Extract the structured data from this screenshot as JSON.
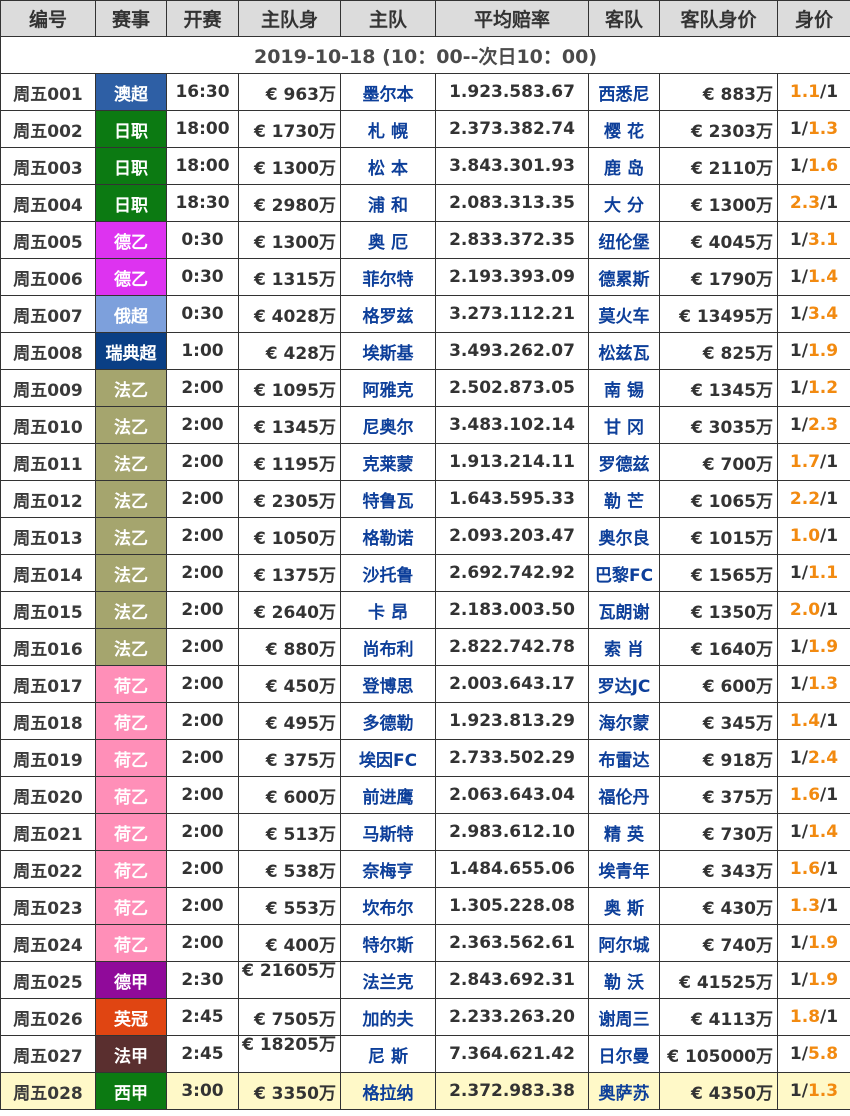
{
  "headers": [
    "编号",
    "赛事",
    "开赛",
    "主队身",
    "主队",
    "平均赔率",
    "客队",
    "客队身价",
    "身价"
  ],
  "date_banner": "2019-10-18 (10：00--次日10：00)",
  "league_colors": {
    "澳超": "#2e5fa5",
    "日职": "#0c7a12",
    "德乙": "#dd33f0",
    "俄超": "#7da0dc",
    "瑞典超": "#0a3f85",
    "法乙": "#a5a56e",
    "荷乙": "#ff8fb8",
    "德甲": "#900a9a",
    "英冠": "#e04512",
    "法甲": "#5a2f2f",
    "西甲": "#0c7a12"
  },
  "rows": [
    {
      "id": "周五001",
      "league": "澳超",
      "time": "16:30",
      "home_val": "€ 963万",
      "home": "墨尔本",
      "odds": "1.923.583.67",
      "away": "西悉尼",
      "away_val": "€ 883万",
      "ratio_a": "1.1",
      "ratio_b": "1",
      "hl": "a"
    },
    {
      "id": "周五002",
      "league": "日职",
      "time": "18:00",
      "home_val": "€ 1730万",
      "home": "札 幌",
      "odds": "2.373.382.74",
      "away": "樱 花",
      "away_val": "€ 2303万",
      "ratio_a": "1",
      "ratio_b": "1.3",
      "hl": "b"
    },
    {
      "id": "周五003",
      "league": "日职",
      "time": "18:00",
      "home_val": "€ 1300万",
      "home": "松 本",
      "odds": "3.843.301.93",
      "away": "鹿 岛",
      "away_val": "€ 2110万",
      "ratio_a": "1",
      "ratio_b": "1.6",
      "hl": "b"
    },
    {
      "id": "周五004",
      "league": "日职",
      "time": "18:30",
      "home_val": "€ 2980万",
      "home": "浦 和",
      "odds": "2.083.313.35",
      "away": "大 分",
      "away_val": "€ 1300万",
      "ratio_a": "2.3",
      "ratio_b": "1",
      "hl": "a"
    },
    {
      "id": "周五005",
      "league": "德乙",
      "time": "0:30",
      "home_val": "€ 1300万",
      "home": "奥 厄",
      "odds": "2.833.372.35",
      "away": "纽伦堡",
      "away_val": "€ 4045万",
      "ratio_a": "1",
      "ratio_b": "3.1",
      "hl": "b"
    },
    {
      "id": "周五006",
      "league": "德乙",
      "time": "0:30",
      "home_val": "€ 1315万",
      "home": "菲尔特",
      "odds": "2.193.393.09",
      "away": "德累斯",
      "away_val": "€ 1790万",
      "ratio_a": "1",
      "ratio_b": "1.4",
      "hl": "b"
    },
    {
      "id": "周五007",
      "league": "俄超",
      "time": "0:30",
      "home_val": "€ 4028万",
      "home": "格罗兹",
      "odds": "3.273.112.21",
      "away": "莫火车",
      "away_val": "€ 13495万",
      "ratio_a": "1",
      "ratio_b": "3.4",
      "hl": "b"
    },
    {
      "id": "周五008",
      "league": "瑞典超",
      "time": "1:00",
      "home_val": "€ 428万",
      "home": "埃斯基",
      "odds": "3.493.262.07",
      "away": "松兹瓦",
      "away_val": "€ 825万",
      "ratio_a": "1",
      "ratio_b": "1.9",
      "hl": "b"
    },
    {
      "id": "周五009",
      "league": "法乙",
      "time": "2:00",
      "home_val": "€ 1095万",
      "home": "阿雅克",
      "odds": "2.502.873.05",
      "away": "南 锡",
      "away_val": "€ 1345万",
      "ratio_a": "1",
      "ratio_b": "1.2",
      "hl": "b"
    },
    {
      "id": "周五010",
      "league": "法乙",
      "time": "2:00",
      "home_val": "€ 1345万",
      "home": "尼奥尔",
      "odds": "3.483.102.14",
      "away": "甘 冈",
      "away_val": "€ 3035万",
      "ratio_a": "1",
      "ratio_b": "2.3",
      "hl": "b"
    },
    {
      "id": "周五011",
      "league": "法乙",
      "time": "2:00",
      "home_val": "€ 1195万",
      "home": "克莱蒙",
      "odds": "1.913.214.11",
      "away": "罗德兹",
      "away_val": "€ 700万",
      "ratio_a": "1.7",
      "ratio_b": "1",
      "hl": "a"
    },
    {
      "id": "周五012",
      "league": "法乙",
      "time": "2:00",
      "home_val": "€ 2305万",
      "home": "特鲁瓦",
      "odds": "1.643.595.33",
      "away": "勒 芒",
      "away_val": "€ 1065万",
      "ratio_a": "2.2",
      "ratio_b": "1",
      "hl": "a"
    },
    {
      "id": "周五013",
      "league": "法乙",
      "time": "2:00",
      "home_val": "€ 1050万",
      "home": "格勒诺",
      "odds": "2.093.203.47",
      "away": "奥尔良",
      "away_val": "€ 1015万",
      "ratio_a": "1.0",
      "ratio_b": "1",
      "hl": "a"
    },
    {
      "id": "周五014",
      "league": "法乙",
      "time": "2:00",
      "home_val": "€ 1375万",
      "home": "沙托鲁",
      "odds": "2.692.742.92",
      "away": "巴黎FC",
      "away_val": "€ 1565万",
      "ratio_a": "1",
      "ratio_b": "1.1",
      "hl": "b"
    },
    {
      "id": "周五015",
      "league": "法乙",
      "time": "2:00",
      "home_val": "€ 2640万",
      "home": "卡 昂",
      "odds": "2.183.003.50",
      "away": "瓦朗谢",
      "away_val": "€ 1350万",
      "ratio_a": "2.0",
      "ratio_b": "1",
      "hl": "a"
    },
    {
      "id": "周五016",
      "league": "法乙",
      "time": "2:00",
      "home_val": "€ 880万",
      "home": "尚布利",
      "odds": "2.822.742.78",
      "away": "索 肖",
      "away_val": "€ 1640万",
      "ratio_a": "1",
      "ratio_b": "1.9",
      "hl": "b"
    },
    {
      "id": "周五017",
      "league": "荷乙",
      "time": "2:00",
      "home_val": "€ 450万",
      "home": "登博思",
      "odds": "2.003.643.17",
      "away": "罗达JC",
      "away_val": "€ 600万",
      "ratio_a": "1",
      "ratio_b": "1.3",
      "hl": "b"
    },
    {
      "id": "周五018",
      "league": "荷乙",
      "time": "2:00",
      "home_val": "€ 495万",
      "home": "多德勒",
      "odds": "1.923.813.29",
      "away": "海尔蒙",
      "away_val": "€ 345万",
      "ratio_a": "1.4",
      "ratio_b": "1",
      "hl": "a"
    },
    {
      "id": "周五019",
      "league": "荷乙",
      "time": "2:00",
      "home_val": "€ 375万",
      "home": "埃因FC",
      "odds": "2.733.502.29",
      "away": "布雷达",
      "away_val": "€ 918万",
      "ratio_a": "1",
      "ratio_b": "2.4",
      "hl": "b"
    },
    {
      "id": "周五020",
      "league": "荷乙",
      "time": "2:00",
      "home_val": "€ 600万",
      "home": "前进鹰",
      "odds": "2.063.643.04",
      "away": "福伦丹",
      "away_val": "€ 375万",
      "ratio_a": "1.6",
      "ratio_b": "1",
      "hl": "a"
    },
    {
      "id": "周五021",
      "league": "荷乙",
      "time": "2:00",
      "home_val": "€ 513万",
      "home": "马斯特",
      "odds": "2.983.612.10",
      "away": "精 英",
      "away_val": "€ 730万",
      "ratio_a": "1",
      "ratio_b": "1.4",
      "hl": "b"
    },
    {
      "id": "周五022",
      "league": "荷乙",
      "time": "2:00",
      "home_val": "€ 538万",
      "home": "奈梅亨",
      "odds": "1.484.655.06",
      "away": "埃青年",
      "away_val": "€ 343万",
      "ratio_a": "1.6",
      "ratio_b": "1",
      "hl": "a"
    },
    {
      "id": "周五023",
      "league": "荷乙",
      "time": "2:00",
      "home_val": "€ 553万",
      "home": "坎布尔",
      "odds": "1.305.228.08",
      "away": "奥 斯",
      "away_val": "€ 430万",
      "ratio_a": "1.3",
      "ratio_b": "1",
      "hl": "a"
    },
    {
      "id": "周五024",
      "league": "荷乙",
      "time": "2:00",
      "home_val": "€ 400万",
      "home": "特尔斯",
      "odds": "2.363.562.61",
      "away": "阿尔城",
      "away_val": "€ 740万",
      "ratio_a": "1",
      "ratio_b": "1.9",
      "hl": "b"
    },
    {
      "id": "周五025",
      "league": "德甲",
      "time": "2:30",
      "home_val": "€ 21605万",
      "home": "法兰克",
      "odds": "2.843.692.31",
      "away": "勒 沃",
      "away_val": "€ 41525万",
      "ratio_a": "1",
      "ratio_b": "1.9",
      "hl": "b",
      "wrap": true
    },
    {
      "id": "周五026",
      "league": "英冠",
      "time": "2:45",
      "home_val": "€ 7505万",
      "home": "加的夫",
      "odds": "2.233.263.20",
      "away": "谢周三",
      "away_val": "€ 4113万",
      "ratio_a": "1.8",
      "ratio_b": "1",
      "hl": "a"
    },
    {
      "id": "周五027",
      "league": "法甲",
      "time": "2:45",
      "home_val": "€ 18205万",
      "home": "尼 斯",
      "odds": "7.364.621.42",
      "away": "日尔曼",
      "away_val": "€ 105000万",
      "ratio_a": "1",
      "ratio_b": "5.8",
      "hl": "b",
      "wrap": true
    },
    {
      "id": "周五028",
      "league": "西甲",
      "time": "3:00",
      "home_val": "€ 3350万",
      "home": "格拉纳",
      "odds": "2.372.983.38",
      "away": "奥萨苏",
      "away_val": "€ 4350万",
      "ratio_a": "1",
      "ratio_b": "1.3",
      "hl": "b",
      "last": true
    }
  ]
}
